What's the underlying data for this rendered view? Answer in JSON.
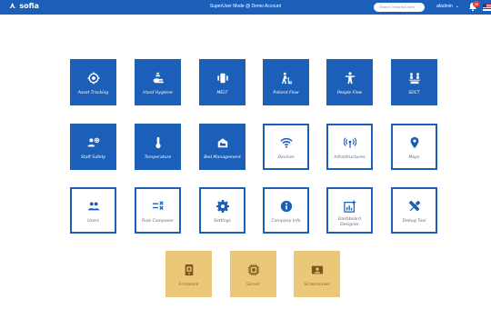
{
  "topbar": {
    "brand": "sofia",
    "mode_text": "SuperUser Mode @ Demo Account",
    "search_placeholder": "Search Tenants/Users",
    "username": "afadmin",
    "notification_count": "35"
  },
  "colors": {
    "primary": "#1c5fb8",
    "gold": "#ebc779",
    "alert": "#e23b3b"
  },
  "tiles": [
    {
      "label": "Asset Tracking",
      "icon": "target-icon",
      "style": "filled"
    },
    {
      "label": "Hand Hygiene",
      "icon": "hand-wash-icon",
      "style": "filled"
    },
    {
      "label": "MELT",
      "icon": "melt-icon",
      "style": "filled"
    },
    {
      "label": "Patient Flow",
      "icon": "patient-walk-icon",
      "style": "filled"
    },
    {
      "label": "People Flow",
      "icon": "person-icon",
      "style": "filled"
    },
    {
      "label": "SDCT",
      "icon": "sdct-icon",
      "style": "filled"
    },
    {
      "label": "Staff Safety",
      "icon": "staff-icon",
      "style": "filled"
    },
    {
      "label": "Temperature",
      "icon": "thermometer-icon",
      "style": "filled"
    },
    {
      "label": "Bed Management",
      "icon": "bed-icon",
      "style": "filled"
    },
    {
      "label": "Devices",
      "icon": "wifi-icon",
      "style": "outline"
    },
    {
      "label": "Infrastructures",
      "icon": "broadcast-icon",
      "style": "outline"
    },
    {
      "label": "Maps",
      "icon": "map-pin-icon",
      "style": "outline"
    },
    {
      "label": "Users",
      "icon": "users-icon",
      "style": "outline"
    },
    {
      "label": "Rule Composer",
      "icon": "rule-icon",
      "style": "outline"
    },
    {
      "label": "Settings",
      "icon": "gear-icon",
      "style": "outline"
    },
    {
      "label": "Company Info",
      "icon": "info-icon",
      "style": "outline"
    },
    {
      "label": "Dashboard Designer",
      "icon": "dashboard-add-icon",
      "style": "outline"
    },
    {
      "label": "Debug Tool",
      "icon": "tools-icon",
      "style": "outline"
    },
    {
      "label": "Firmware",
      "icon": "firmware-icon",
      "style": "gold"
    },
    {
      "label": "Server",
      "icon": "chip-icon",
      "style": "gold"
    },
    {
      "label": "Screensaver",
      "icon": "screensaver-icon",
      "style": "gold"
    }
  ]
}
